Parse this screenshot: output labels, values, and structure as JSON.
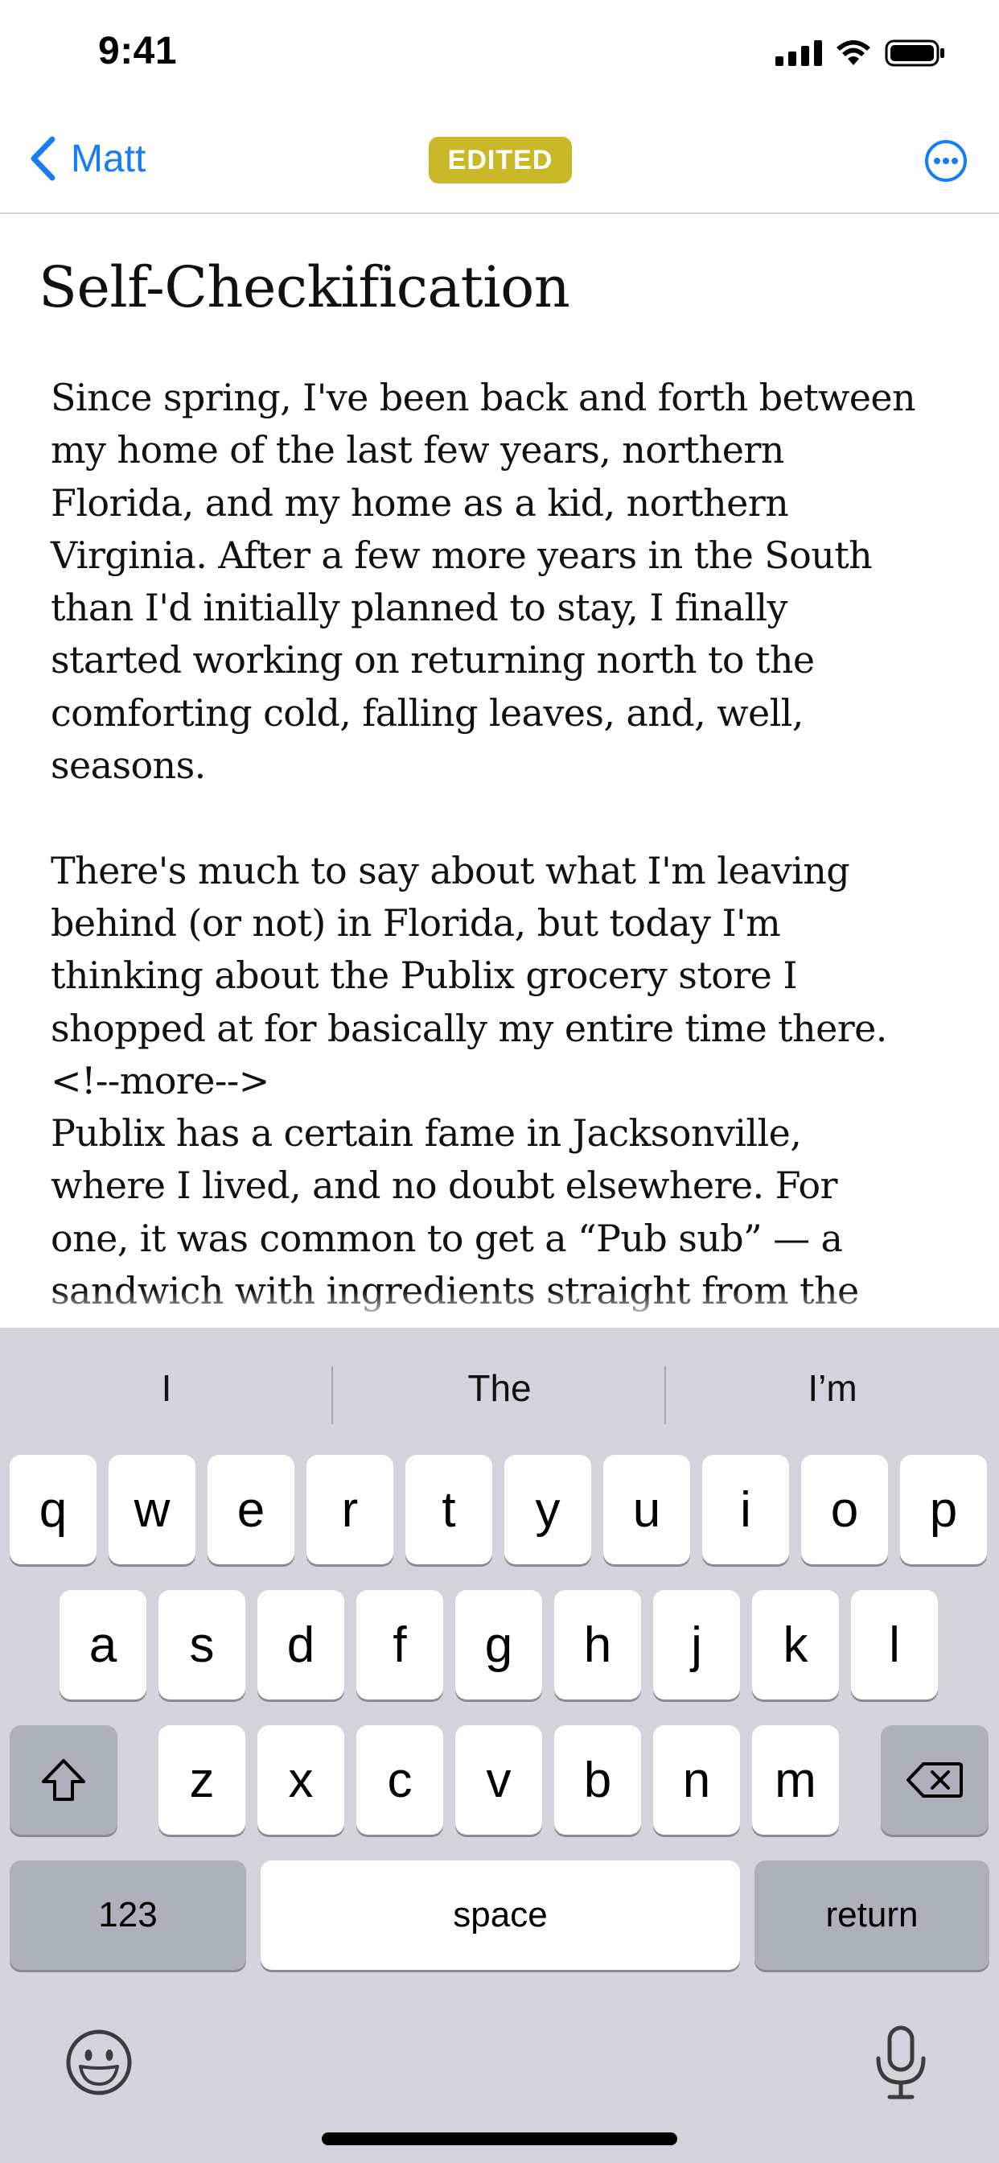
{
  "status_bar": {
    "time": "9:41",
    "signal_icon": "cellular-signal-icon",
    "wifi_icon": "wifi-icon",
    "battery_icon": "battery-icon"
  },
  "nav": {
    "back_label": "Matt",
    "back_icon": "chevron-left-icon",
    "badge": "EDITED",
    "badge_color": "#c9b827",
    "more_icon": "ellipsis-circle-icon",
    "accent": "#1a7cf5"
  },
  "post": {
    "title": "Self-Checkification",
    "lines": [
      "Since spring, I've been back and forth between",
      "my home of the last few years, northern",
      "Florida, and my home as a kid, northern",
      "Virginia. After a few more years in the South",
      "than I'd initially planned to stay, I finally",
      "started working on returning north to the",
      "comforting cold, falling leaves, and, well,",
      "seasons.",
      "",
      "There's much to say about what I'm leaving",
      "behind (or not) in Florida, but today I'm",
      "thinking about the Publix grocery store I",
      "shopped at for basically my entire time there.",
      "<!--more-->",
      "Publix has a certain fame in Jacksonville,",
      "where I lived, and no doubt elsewhere. For",
      "one, it was common to get a “Pub sub” — a",
      "sandwich with ingredients straight from the"
    ]
  },
  "keyboard": {
    "suggestions": [
      "I",
      "The",
      "I’m"
    ],
    "row1": [
      "q",
      "w",
      "e",
      "r",
      "t",
      "y",
      "u",
      "i",
      "o",
      "p"
    ],
    "row2": [
      "a",
      "s",
      "d",
      "f",
      "g",
      "h",
      "j",
      "k",
      "l"
    ],
    "row3": [
      "z",
      "x",
      "c",
      "v",
      "b",
      "n",
      "m"
    ],
    "shift_icon": "shift-icon",
    "delete_icon": "delete-backspace-icon",
    "numbers_label": "123",
    "space_label": "space",
    "return_label": "return",
    "emoji_icon": "emoji-icon",
    "mic_icon": "microphone-icon"
  }
}
